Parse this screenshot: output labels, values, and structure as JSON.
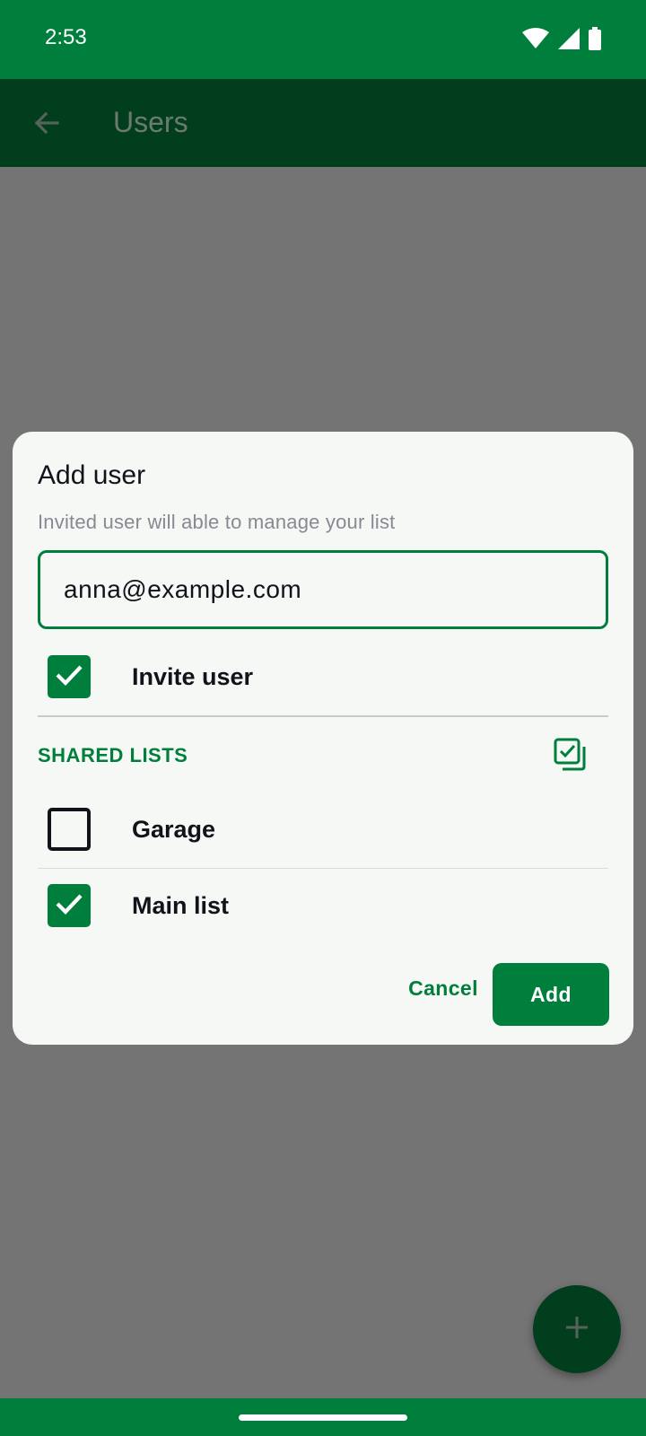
{
  "status_bar": {
    "time": "2:53",
    "icons": [
      "wifi-icon",
      "cellular-signal-icon",
      "battery-icon"
    ]
  },
  "app_bar": {
    "title": "Users",
    "back_icon": "arrow-back-icon"
  },
  "dialog": {
    "title": "Add user",
    "subtitle": "Invited user will able to manage your list",
    "email_value": "anna@example.com",
    "invite": {
      "label": "Invite user",
      "checked": true
    },
    "shared_lists": {
      "header": "SHARED LISTS",
      "select_all_icon": "select-all-icon",
      "items": [
        {
          "label": "Garage",
          "checked": false
        },
        {
          "label": "Main list",
          "checked": true
        }
      ]
    },
    "cancel_label": "Cancel",
    "add_label": "Add"
  },
  "fab": {
    "icon": "plus-icon"
  },
  "colors": {
    "primary": "#007f3c",
    "primary_dark": "#003e1e",
    "scrim": "#747474",
    "dialog_bg": "#f5f8f5"
  }
}
